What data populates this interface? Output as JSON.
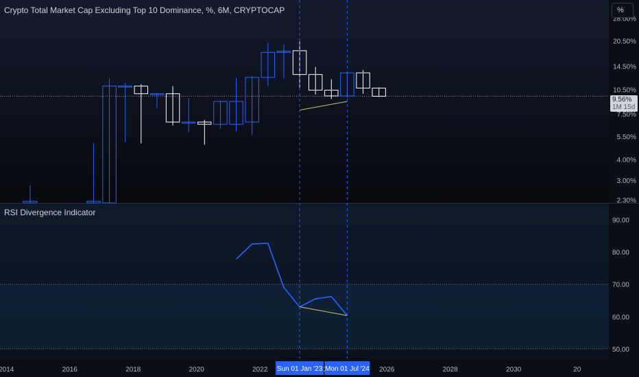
{
  "header": {
    "title": "Crypto Total Market Cap Excluding Top 10 Dominance, %, 6M, CRYPTOCAP",
    "unit_button": "%"
  },
  "price_badge": {
    "value": "9.56%",
    "countdown": "1M 15d"
  },
  "colors": {
    "background": "#0b0e15",
    "up_candle": "#2962ff",
    "down_candle": "#ffffff",
    "rsi_line": "#2962ff",
    "divergence_line": "#c9c46a",
    "date_highlight": "#2962ff"
  },
  "chart_data": [
    {
      "type": "candlestick",
      "title": "Crypto Total Market Cap Excluding Top 10 Dominance, %, 6M, CRYPTOCAP",
      "ylabel": "%",
      "y_scale": "log",
      "ylim": [
        2.2,
        36
      ],
      "xlim": [
        2013.8,
        2033
      ],
      "x_ticks": [
        "2014",
        "2016",
        "2018",
        "2020",
        "2022",
        "2024",
        "2026",
        "2028",
        "2030",
        "20"
      ],
      "y_ticks": [
        "28.00%",
        "20.50%",
        "14.50%",
        "10.50%",
        "7.50%",
        "5.50%",
        "4.00%",
        "3.00%",
        "2.30%"
      ],
      "last_price": 9.56,
      "candles": [
        {
          "date": "2014-07",
          "open": 2.2,
          "high": 2.8,
          "low": 2.2,
          "close": 2.25
        },
        {
          "date": "2016-07",
          "open": 2.2,
          "high": 5.0,
          "low": 2.2,
          "close": 2.25
        },
        {
          "date": "2017-01",
          "open": 2.2,
          "high": 12.2,
          "low": 2.2,
          "close": 11.0
        },
        {
          "date": "2017-07",
          "open": 11.0,
          "high": 11.5,
          "low": 5.1,
          "close": 11.0
        },
        {
          "date": "2018-01",
          "open": 11.0,
          "high": 11.3,
          "low": 5.0,
          "close": 9.9
        },
        {
          "date": "2018-07",
          "open": 9.9,
          "high": 10.0,
          "low": 8.1,
          "close": 9.9
        },
        {
          "date": "2019-01",
          "open": 9.9,
          "high": 11.0,
          "low": 6.4,
          "close": 6.7
        },
        {
          "date": "2019-07",
          "open": 6.6,
          "high": 9.3,
          "low": 5.8,
          "close": 6.7
        },
        {
          "date": "2020-01",
          "open": 6.7,
          "high": 6.9,
          "low": 4.9,
          "close": 6.5
        },
        {
          "date": "2020-07",
          "open": 6.5,
          "high": 9.0,
          "low": 6.1,
          "close": 8.9
        },
        {
          "date": "2021-01",
          "open": 6.5,
          "high": 12.3,
          "low": 5.9,
          "close": 8.9
        },
        {
          "date": "2021-07",
          "open": 6.7,
          "high": 12.6,
          "low": 5.6,
          "close": 12.4
        },
        {
          "date": "2022-01",
          "open": 12.4,
          "high": 20.0,
          "low": 11.0,
          "close": 17.5
        },
        {
          "date": "2022-07",
          "open": 17.5,
          "high": 19.5,
          "low": 12.2,
          "close": 17.8
        },
        {
          "date": "2023-01",
          "open": 17.9,
          "high": 20.3,
          "low": 10.8,
          "close": 12.9
        },
        {
          "date": "2023-07",
          "open": 12.9,
          "high": 14.3,
          "low": 9.8,
          "close": 10.4
        },
        {
          "date": "2024-01",
          "open": 10.4,
          "high": 12.1,
          "low": 9.2,
          "close": 9.6
        },
        {
          "date": "2024-07",
          "open": 9.6,
          "high": 13.4,
          "low": 9.4,
          "close": 13.2
        },
        {
          "date": "2025-01",
          "open": 13.2,
          "high": 13.7,
          "low": 9.9,
          "close": 10.7
        },
        {
          "date": "2025-07",
          "open": 10.7,
          "high": 10.8,
          "low": 9.45,
          "close": 9.56
        }
      ],
      "divergence_line": {
        "from": {
          "date": "2023-01",
          "value": 7.9
        },
        "to": {
          "date": "2024-07",
          "value": 8.9
        }
      },
      "vertical_markers": [
        "2023-01",
        "2024-07"
      ]
    },
    {
      "type": "line",
      "title": "RSI Divergence Indicator",
      "ylim": [
        47,
        95
      ],
      "y_ticks": [
        "90.00",
        "80.00",
        "70.00",
        "60.00",
        "50.00"
      ],
      "reference_lines": [
        70,
        50
      ],
      "band": [
        50,
        70
      ],
      "series": [
        {
          "x": [
            "2021-01",
            "2021-07",
            "2022-01",
            "2022-07",
            "2023-01",
            "2023-07",
            "2024-01",
            "2024-07"
          ],
          "values": [
            77.8,
            82.5,
            82.7,
            69.0,
            63.0,
            65.5,
            66.2,
            60.3
          ]
        }
      ],
      "divergence_line": {
        "from": {
          "date": "2023-01",
          "value": 63.0
        },
        "to": {
          "date": "2024-07",
          "value": 60.3
        }
      }
    }
  ],
  "date_labels": [
    "Sun 01 Jan '23",
    "Mon 01 Jul '24"
  ]
}
